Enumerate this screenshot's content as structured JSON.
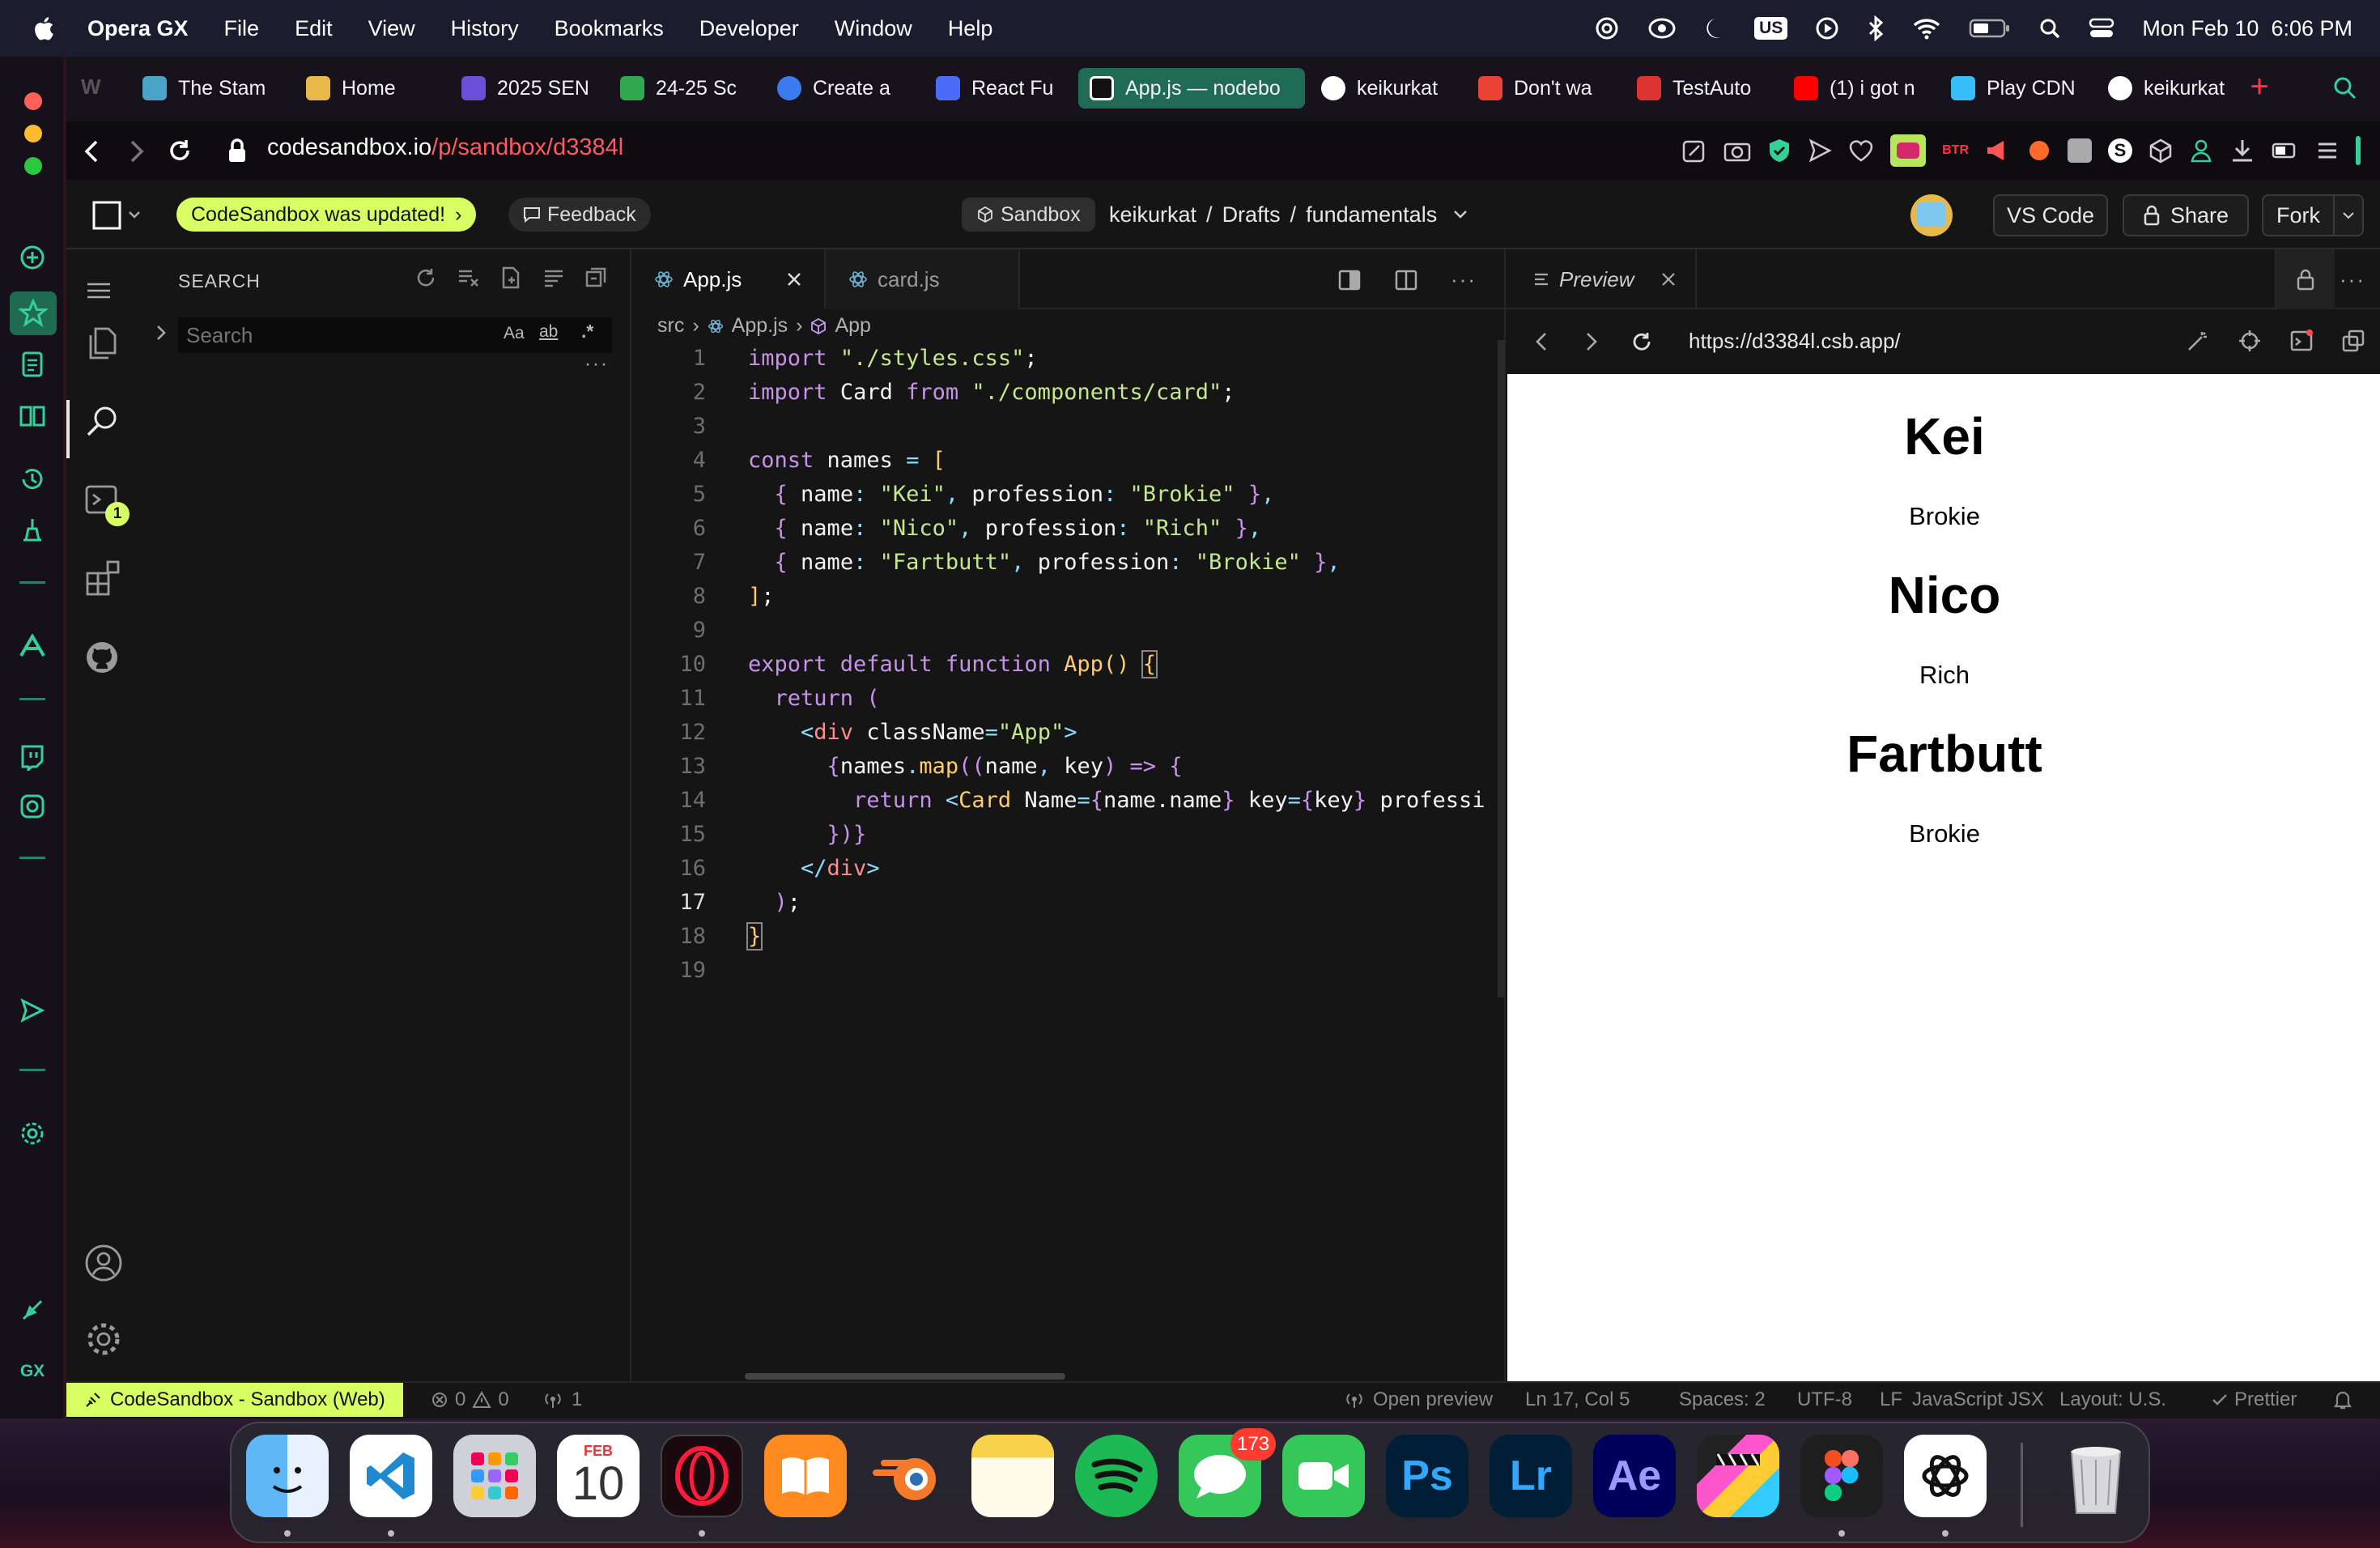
{
  "menubar": {
    "apple": "",
    "app_name": "Opera GX",
    "menus": [
      "File",
      "Edit",
      "View",
      "History",
      "Bookmarks",
      "Developer",
      "Window",
      "Help"
    ],
    "keyboard": "US",
    "datetime": "Mon Feb 10  6:06 PM"
  },
  "tabs": [
    {
      "label": "The Stam",
      "color": "#4ba3c7"
    },
    {
      "label": "Home",
      "color": "#e8b84a"
    },
    {
      "label": "2025 SEN",
      "color": "#6a4fd8"
    },
    {
      "label": "24-25 Sc",
      "color": "#2fa84f"
    },
    {
      "label": "Create a",
      "color": "#3a7bf0"
    },
    {
      "label": "React Fu",
      "color": "#4a6cf7"
    },
    {
      "label": "App.js — nodebo",
      "color": "#111111"
    },
    {
      "label": "keikurkat",
      "color": "#ffffff"
    },
    {
      "label": "Don't wa",
      "color": "#ea4335"
    },
    {
      "label": "TestAuto",
      "color": "#d33"
    },
    {
      "label": "(1) i got n",
      "color": "#ff0000"
    },
    {
      "label": "Play CDN",
      "color": "#38bdf8"
    },
    {
      "label": "keikurkat",
      "color": "#ffffff"
    }
  ],
  "address": {
    "domain": "codesandbox.io",
    "path": "/p/sandbox/d3384l"
  },
  "csb_header": {
    "updated_badge": "CodeSandbox was updated!",
    "feedback": "Feedback",
    "sandbox_badge": "Sandbox",
    "breadcrumb_user": "keikurkat",
    "breadcrumb_folder": "Drafts",
    "breadcrumb_project": "fundamentals",
    "vscode": "VS Code",
    "share": "Share",
    "fork": "Fork"
  },
  "activity": {
    "badge": "1"
  },
  "search_panel": {
    "title": "SEARCH",
    "placeholder": "Search",
    "opt_case": "Aa",
    "opt_word": "ab",
    "opt_regex": ".*"
  },
  "editor": {
    "tabs": [
      {
        "label": "App.js"
      },
      {
        "label": "card.js"
      }
    ],
    "breadcrumb": [
      "src",
      "App.js",
      "App"
    ],
    "current_line": 17
  },
  "preview": {
    "tab_label": "Preview",
    "url": "https://d3384l.csb.app/",
    "cards": [
      {
        "name": "Kei",
        "profession": "Brokie"
      },
      {
        "name": "Nico",
        "profession": "Rich"
      },
      {
        "name": "Fartbutt",
        "profession": "Brokie"
      }
    ]
  },
  "statusbar": {
    "sandbox_label": "CodeSandbox - Sandbox (Web)",
    "errors": "0",
    "warnings": "0",
    "ports": "1",
    "open_preview": "Open preview",
    "position": "Ln 17, Col 5",
    "spaces": "Spaces: 2",
    "encoding": "UTF-8",
    "eol": "LF",
    "language": "JavaScript JSX",
    "layout": "Layout: U.S.",
    "prettier": "Prettier"
  },
  "dock": {
    "calendar_month": "FEB",
    "calendar_day": "10",
    "messages_badge": "173",
    "ps": "Ps",
    "lr": "Lr",
    "ae": "Ae"
  },
  "opera_side": {
    "gx": "GX"
  },
  "colors": {
    "accent": "#d7ff64",
    "opera_green": "#35d09a",
    "brand_red": "#ff3347"
  }
}
